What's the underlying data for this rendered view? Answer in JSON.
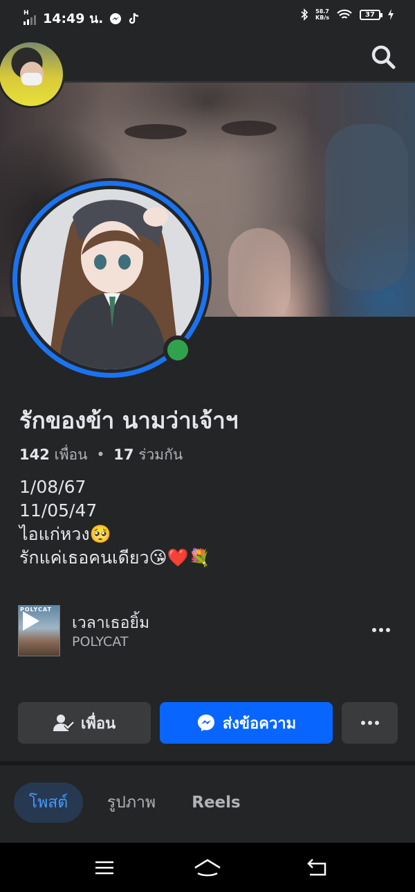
{
  "status_bar": {
    "time": "14:49 น.",
    "network_type": "H",
    "net_speed_value": "58.7",
    "net_speed_unit": "KB/s",
    "battery": "37",
    "icons": [
      "messenger-icon",
      "tiktok-icon",
      "bluetooth-icon",
      "wifi-icon",
      "battery-icon",
      "charging-icon"
    ]
  },
  "header": {
    "search_icon": "search-icon"
  },
  "profile": {
    "name": "รักของข้า นามว่าเจ้าฯ",
    "friends_count": "142",
    "friends_label": "เพื่อน",
    "separator": "•",
    "mutual_count": "17",
    "mutual_label": "ร่วมกัน",
    "online": true,
    "online_color": "#31a24c",
    "ring_color": "#1a74f2"
  },
  "bio": {
    "lines": [
      "1/08/67",
      "11/05/47",
      "ไอแก่หวง🥺",
      "รักแค่เธอคนเดียว😘❤️💐"
    ]
  },
  "music": {
    "title": "เวลาเธอยิ้ม",
    "artist": "POLYCAT",
    "album_text": "POLYCAT"
  },
  "actions": {
    "friend_label": "เพื่อน",
    "message_label": "ส่งข้อความ",
    "message_color": "#0866ff"
  },
  "tabs": [
    {
      "label": "โพสต์",
      "active": true
    },
    {
      "label": "รูปภาพ",
      "active": false
    },
    {
      "label": "Reels",
      "active": false
    }
  ],
  "nav": {
    "icons": [
      "menu-icon",
      "home-icon",
      "back-icon"
    ]
  }
}
